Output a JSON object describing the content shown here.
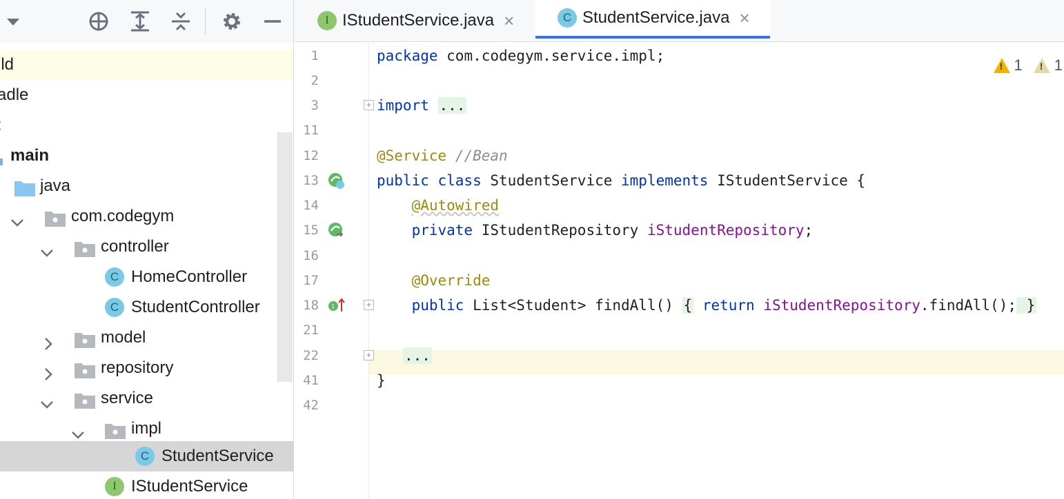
{
  "project_panel": {
    "toolbar_icons": [
      "chevron-down-icon",
      "locate-icon",
      "expand-all-icon",
      "collapse-all-icon",
      "gear-icon",
      "minimize-icon"
    ],
    "tree": [
      {
        "label": "ild"
      },
      {
        "label": "adle"
      },
      {
        "label": ":"
      },
      {
        "label": "main"
      },
      {
        "label": "java"
      },
      {
        "label": "com.codegym"
      },
      {
        "label": "controller"
      },
      {
        "label": "HomeController"
      },
      {
        "label": "StudentController"
      },
      {
        "label": "model"
      },
      {
        "label": "repository"
      },
      {
        "label": "service"
      },
      {
        "label": "impl"
      },
      {
        "label": "StudentService"
      },
      {
        "label": "IStudentService"
      }
    ]
  },
  "editor": {
    "tabs": [
      {
        "label": "IStudentService.java",
        "badge": "I",
        "close": "×"
      },
      {
        "label": "StudentService.java",
        "badge": "C",
        "close": "×"
      }
    ],
    "inspection": {
      "warnings": "1",
      "weak_warnings": "1"
    },
    "line_numbers": [
      "1",
      "2",
      "3",
      "11",
      "12",
      "13",
      "14",
      "15",
      "16",
      "17",
      "18",
      "21",
      "22",
      "41",
      "42"
    ],
    "code": {
      "l1_kw": "package",
      "l1_rest": " com.codegym.service.impl;",
      "l3_kw": "import",
      "l3_fold": "...",
      "l12_ann": "@Service",
      "l12_cmt": " //Bean",
      "l13_kw1": "public class",
      "l13_name": " StudentService ",
      "l13_kw2": "implements",
      "l13_rest": " IStudentService {",
      "l14_ann": "@Autowired",
      "l15_kw": "private",
      "l15_type": " IStudentRepository ",
      "l15_field": "iStudentRepository",
      "l15_end": ";",
      "l17_ann": "@Override",
      "l18_kw": "public",
      "l18_sig": " List<Student> findAll() ",
      "l18_open": "{",
      "l18_ret": " return ",
      "l18_field": "iStudentRepository",
      "l18_call": ".findAll();",
      "l18_close": " }",
      "l22_fold": "...",
      "l41": "}"
    },
    "badge_letters": {
      "class": "C",
      "interface": "I"
    }
  }
}
